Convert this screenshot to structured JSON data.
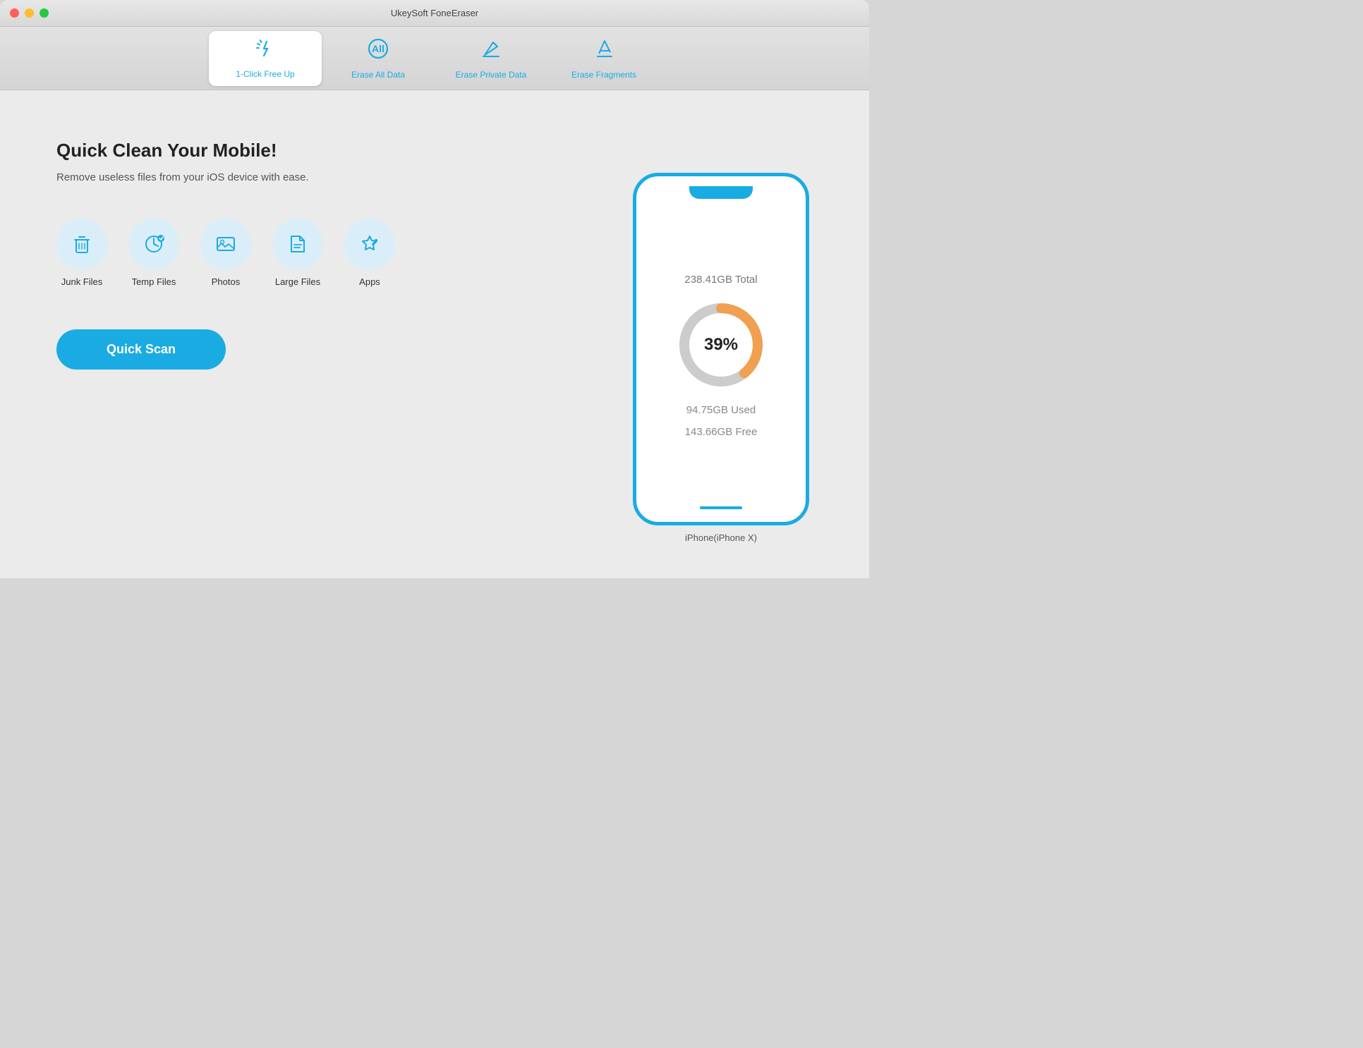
{
  "titleBar": {
    "title": "UkeySoft FoneEraser"
  },
  "tabs": [
    {
      "id": "one-click",
      "label": "1-Click Free Up",
      "active": true
    },
    {
      "id": "erase-all",
      "label": "Erase All Data",
      "active": false
    },
    {
      "id": "erase-private",
      "label": "Erase Private Data",
      "active": false
    },
    {
      "id": "erase-fragments",
      "label": "Erase Fragments",
      "active": false
    }
  ],
  "main": {
    "headline": "Quick Clean Your Mobile!",
    "subtext": "Remove useless files from your iOS device with ease.",
    "icons": [
      {
        "id": "junk-files",
        "label": "Junk Files"
      },
      {
        "id": "temp-files",
        "label": "Temp Files"
      },
      {
        "id": "photos",
        "label": "Photos"
      },
      {
        "id": "large-files",
        "label": "Large Files"
      },
      {
        "id": "apps",
        "label": "Apps"
      }
    ],
    "quickScanButton": "Quick Scan"
  },
  "device": {
    "storageTotal": "238.41GB Total",
    "storageUsed": "94.75GB Used",
    "storageFree": "143.66GB Free",
    "usedPercent": 39,
    "label": "iPhone(iPhone X)"
  },
  "donut": {
    "usedColor": "#f0a050",
    "freeColor": "#cccccc",
    "percentLabel": "39%"
  }
}
